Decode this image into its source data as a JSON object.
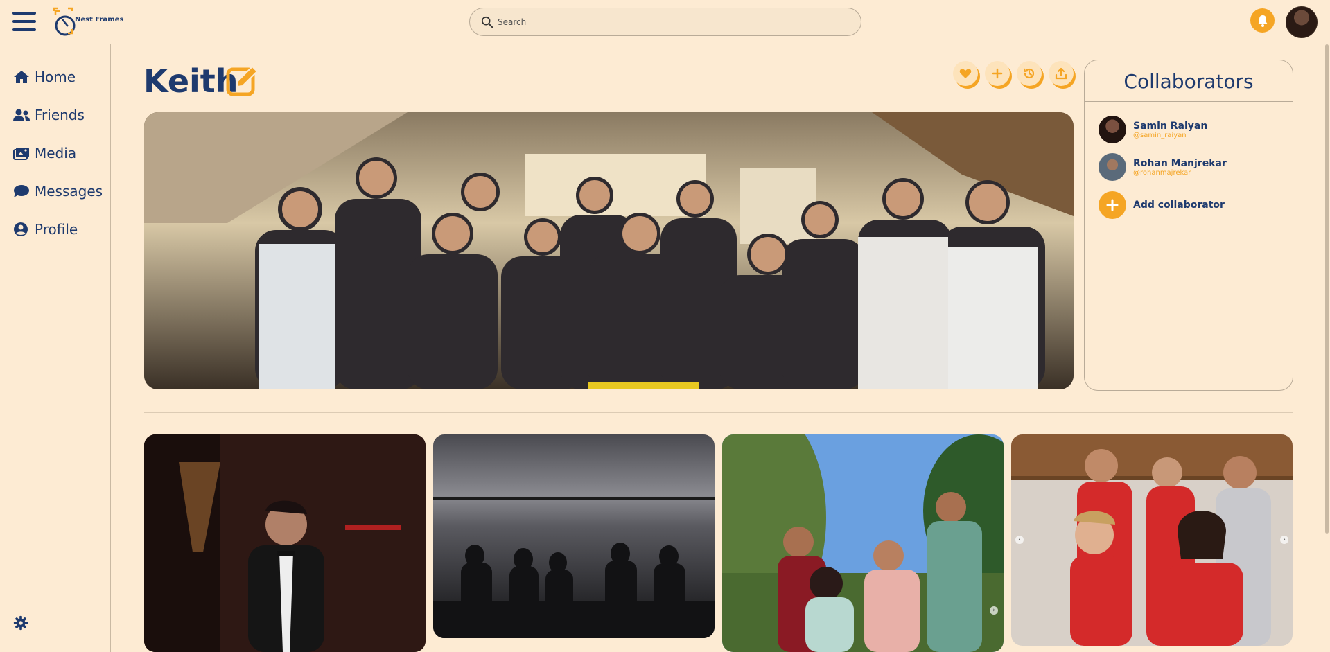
{
  "app": {
    "brand": "Nest Frames",
    "search_placeholder": "Search"
  },
  "sidebar": {
    "items": [
      {
        "label": "Home",
        "icon": "home-icon"
      },
      {
        "label": "Friends",
        "icon": "friends-icon"
      },
      {
        "label": "Media",
        "icon": "media-icon"
      },
      {
        "label": "Messages",
        "icon": "messages-icon"
      },
      {
        "label": "Profile",
        "icon": "profile-icon"
      }
    ],
    "settings_icon": "gear-icon"
  },
  "album": {
    "title": "Keith",
    "actions": [
      "heart-icon",
      "plus-icon",
      "history-icon",
      "share-icon"
    ]
  },
  "collaborators": {
    "title": "Collaborators",
    "people": [
      {
        "name": "Samin Raiyan",
        "handle": "@samin_raiyan"
      },
      {
        "name": "Rohan Manjrekar",
        "handle": "@rohanmajrekar"
      }
    ],
    "add_label": "Add collaborator"
  },
  "colors": {
    "background": "#fdebd3",
    "primary": "#1e3a6e",
    "accent": "#f5a524"
  }
}
